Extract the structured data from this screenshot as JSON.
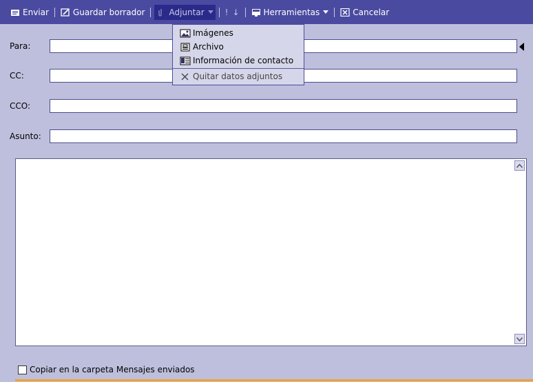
{
  "toolbar": {
    "send_label": "Enviar",
    "save_draft_label": "Guardar borrador",
    "attach_label": "Adjuntar",
    "priority_high": "!",
    "priority_low": "↓",
    "tools_label": "Herramientas",
    "cancel_label": "Cancelar"
  },
  "attach_menu": {
    "items": [
      {
        "label": "Imágenes",
        "icon": "image-icon"
      },
      {
        "label": "Archivo",
        "icon": "file-icon"
      },
      {
        "label": "Información de contacto",
        "icon": "contact-card-icon"
      }
    ],
    "remove_label": "Quitar datos adjuntos"
  },
  "form": {
    "to_label": "Para:",
    "to_value": "",
    "cc_label": "CC:",
    "cc_value": "",
    "bcc_label": "CCO:",
    "bcc_value": "",
    "subject_label": "Asunto:",
    "subject_value": ""
  },
  "footer": {
    "save_copy_label": "Copiar en la carpeta Mensajes enviados",
    "save_copy_checked": false
  },
  "colors": {
    "toolbar_bg": "#4a4aa0",
    "page_bg": "#bebfdc",
    "accent_orange": "#f0a030"
  }
}
